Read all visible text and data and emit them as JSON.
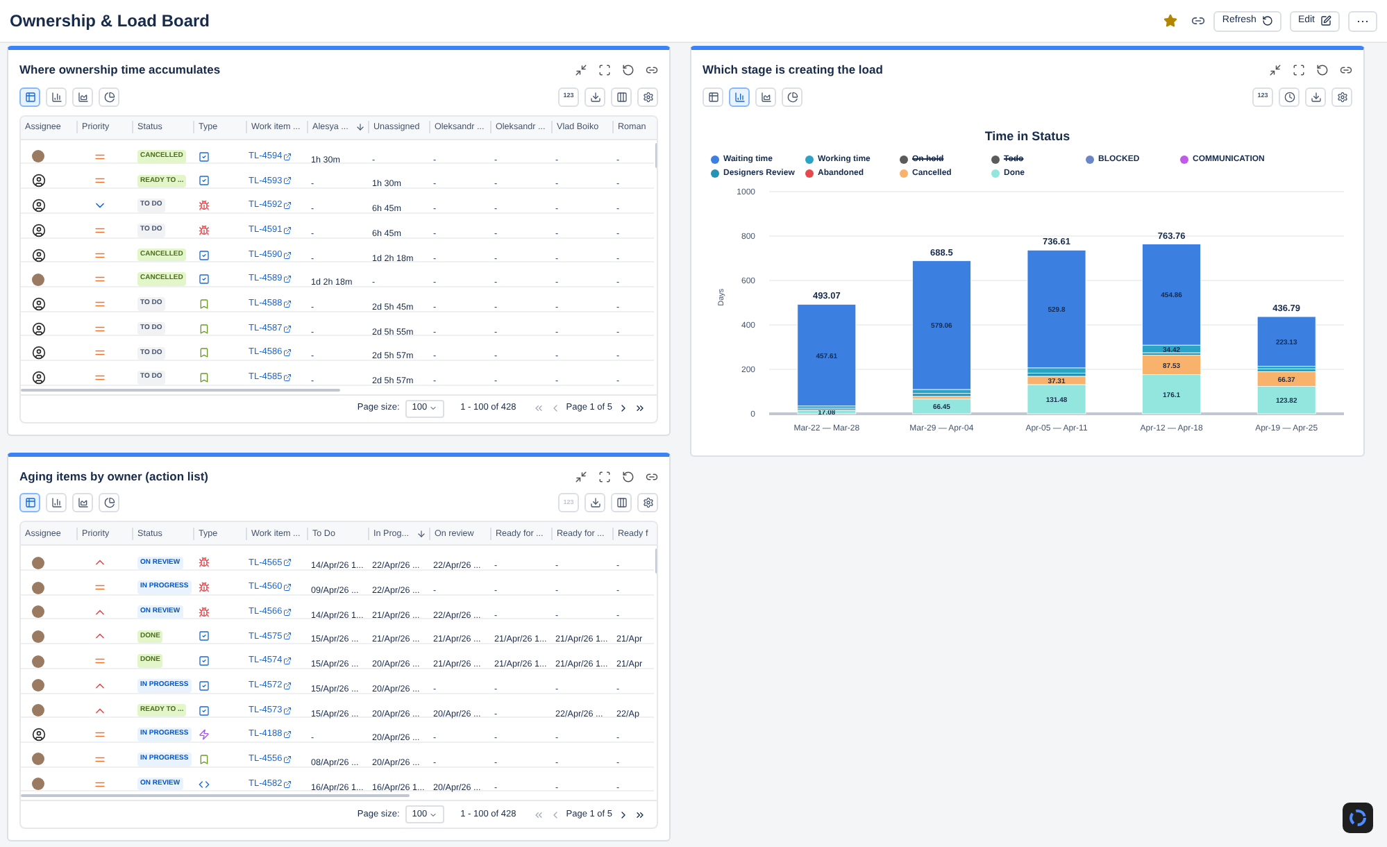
{
  "header": {
    "title": "Ownership & Load Board",
    "favorite": true,
    "refresh_label": "Refresh",
    "edit_label": "Edit",
    "more_label": "⋯"
  },
  "panels": [
    {
      "kind": "table",
      "title": "Where ownership time accumulates",
      "views": [
        {
          "kind": "table",
          "selected": true
        },
        {
          "kind": "bar",
          "selected": false
        },
        {
          "kind": "area",
          "selected": false
        },
        {
          "kind": "pie",
          "selected": false
        }
      ],
      "tools": [
        {
          "kind": "digits",
          "label": "123",
          "disabled": false
        },
        {
          "kind": "download",
          "disabled": false
        },
        {
          "kind": "columns",
          "disabled": false
        },
        {
          "kind": "settings",
          "disabled": false
        }
      ],
      "table": {
        "columns": [
          {
            "label": "Assignee",
            "sorted": false
          },
          {
            "label": "Priority",
            "sorted": false
          },
          {
            "label": "Status",
            "sorted": false
          },
          {
            "label": "Type",
            "sorted": false
          },
          {
            "label": "Work item ...",
            "sorted": false
          },
          {
            "label": "Alesya ...",
            "sorted": true
          },
          {
            "label": "Unassigned",
            "sorted": false
          },
          {
            "label": "Oleksandr ...",
            "sorted": false
          },
          {
            "label": "Oleksandr ...",
            "sorted": false
          },
          {
            "label": "Vlad Boiko",
            "sorted": false
          },
          {
            "label": "Roman",
            "sorted": false
          }
        ],
        "rows": [
          {
            "cells": [
              {
                "kind": "photo"
              },
              {
                "kind": "medium"
              },
              {
                "kind": "positive",
                "text": "CANCELLED"
              },
              {
                "kind": "task"
              },
              {
                "kind": "link",
                "text": "TL-4594"
              },
              {
                "kind": "text",
                "text": "1h 30m"
              },
              {
                "kind": "text",
                "text": "-"
              },
              {
                "kind": "text",
                "text": "-"
              },
              {
                "kind": "text",
                "text": "-"
              },
              {
                "kind": "text",
                "text": "-"
              },
              {
                "kind": "text",
                "text": "-"
              }
            ]
          },
          {
            "cells": [
              {
                "kind": "person"
              },
              {
                "kind": "medium"
              },
              {
                "kind": "positive",
                "text": "READY TO ..."
              },
              {
                "kind": "task"
              },
              {
                "kind": "link",
                "text": "TL-4593"
              },
              {
                "kind": "text",
                "text": "-"
              },
              {
                "kind": "text",
                "text": "1h 30m"
              },
              {
                "kind": "text",
                "text": "-"
              },
              {
                "kind": "text",
                "text": "-"
              },
              {
                "kind": "text",
                "text": "-"
              },
              {
                "kind": "text",
                "text": "-"
              }
            ]
          },
          {
            "cells": [
              {
                "kind": "person"
              },
              {
                "kind": "low"
              },
              {
                "kind": "neutral",
                "text": "TO DO"
              },
              {
                "kind": "bug"
              },
              {
                "kind": "link",
                "text": "TL-4592"
              },
              {
                "kind": "text",
                "text": "-"
              },
              {
                "kind": "text",
                "text": "6h 45m"
              },
              {
                "kind": "text",
                "text": "-"
              },
              {
                "kind": "text",
                "text": "-"
              },
              {
                "kind": "text",
                "text": "-"
              },
              {
                "kind": "text",
                "text": "-"
              }
            ]
          },
          {
            "cells": [
              {
                "kind": "person"
              },
              {
                "kind": "medium"
              },
              {
                "kind": "neutral",
                "text": "TO DO"
              },
              {
                "kind": "bug"
              },
              {
                "kind": "link",
                "text": "TL-4591"
              },
              {
                "kind": "text",
                "text": "-"
              },
              {
                "kind": "text",
                "text": "6h 45m"
              },
              {
                "kind": "text",
                "text": "-"
              },
              {
                "kind": "text",
                "text": "-"
              },
              {
                "kind": "text",
                "text": "-"
              },
              {
                "kind": "text",
                "text": "-"
              }
            ]
          },
          {
            "cells": [
              {
                "kind": "person"
              },
              {
                "kind": "medium"
              },
              {
                "kind": "positive",
                "text": "CANCELLED"
              },
              {
                "kind": "task"
              },
              {
                "kind": "link",
                "text": "TL-4590"
              },
              {
                "kind": "text",
                "text": "-"
              },
              {
                "kind": "text",
                "text": "1d 2h 18m"
              },
              {
                "kind": "text",
                "text": "-"
              },
              {
                "kind": "text",
                "text": "-"
              },
              {
                "kind": "text",
                "text": "-"
              },
              {
                "kind": "text",
                "text": "-"
              }
            ]
          },
          {
            "cells": [
              {
                "kind": "photo"
              },
              {
                "kind": "medium"
              },
              {
                "kind": "positive",
                "text": "CANCELLED"
              },
              {
                "kind": "task"
              },
              {
                "kind": "link",
                "text": "TL-4589"
              },
              {
                "kind": "text",
                "text": "1d 2h 18m"
              },
              {
                "kind": "text",
                "text": "-"
              },
              {
                "kind": "text",
                "text": "-"
              },
              {
                "kind": "text",
                "text": "-"
              },
              {
                "kind": "text",
                "text": "-"
              },
              {
                "kind": "text",
                "text": "-"
              }
            ]
          },
          {
            "cells": [
              {
                "kind": "person"
              },
              {
                "kind": "medium"
              },
              {
                "kind": "neutral",
                "text": "TO DO"
              },
              {
                "kind": "story"
              },
              {
                "kind": "link",
                "text": "TL-4588"
              },
              {
                "kind": "text",
                "text": "-"
              },
              {
                "kind": "text",
                "text": "2d 5h 45m"
              },
              {
                "kind": "text",
                "text": "-"
              },
              {
                "kind": "text",
                "text": "-"
              },
              {
                "kind": "text",
                "text": "-"
              },
              {
                "kind": "text",
                "text": "-"
              }
            ]
          },
          {
            "cells": [
              {
                "kind": "person"
              },
              {
                "kind": "medium"
              },
              {
                "kind": "neutral",
                "text": "TO DO"
              },
              {
                "kind": "story"
              },
              {
                "kind": "link",
                "text": "TL-4587"
              },
              {
                "kind": "text",
                "text": "-"
              },
              {
                "kind": "text",
                "text": "2d 5h 55m"
              },
              {
                "kind": "text",
                "text": "-"
              },
              {
                "kind": "text",
                "text": "-"
              },
              {
                "kind": "text",
                "text": "-"
              },
              {
                "kind": "text",
                "text": "-"
              }
            ]
          },
          {
            "cells": [
              {
                "kind": "person"
              },
              {
                "kind": "medium"
              },
              {
                "kind": "neutral",
                "text": "TO DO"
              },
              {
                "kind": "story"
              },
              {
                "kind": "link",
                "text": "TL-4586"
              },
              {
                "kind": "text",
                "text": "-"
              },
              {
                "kind": "text",
                "text": "2d 5h 57m"
              },
              {
                "kind": "text",
                "text": "-"
              },
              {
                "kind": "text",
                "text": "-"
              },
              {
                "kind": "text",
                "text": "-"
              },
              {
                "kind": "text",
                "text": "-"
              }
            ]
          },
          {
            "cells": [
              {
                "kind": "person"
              },
              {
                "kind": "medium"
              },
              {
                "kind": "neutral",
                "text": "TO DO"
              },
              {
                "kind": "story"
              },
              {
                "kind": "link",
                "text": "TL-4585"
              },
              {
                "kind": "text",
                "text": "-"
              },
              {
                "kind": "text",
                "text": "2d 5h 57m"
              },
              {
                "kind": "text",
                "text": "-"
              },
              {
                "kind": "text",
                "text": "-"
              },
              {
                "kind": "text",
                "text": "-"
              },
              {
                "kind": "text",
                "text": "-"
              }
            ]
          }
        ]
      },
      "pagination": {
        "size_label": "Page size:",
        "size": "100",
        "range": "1 - 100 of 428",
        "page": "Page 1 of 5"
      }
    },
    {
      "kind": "chart",
      "title": "Which stage is creating the load",
      "views": [
        {
          "kind": "table",
          "selected": false
        },
        {
          "kind": "bar",
          "selected": true
        },
        {
          "kind": "area",
          "selected": false
        },
        {
          "kind": "pie",
          "selected": false
        }
      ],
      "tools": [
        {
          "kind": "digits",
          "label": "123",
          "disabled": false
        },
        {
          "kind": "history",
          "disabled": false
        },
        {
          "kind": "download",
          "disabled": false
        },
        {
          "kind": "settings",
          "disabled": false
        }
      ],
      "legend_states": [
        {
          "struck": false
        },
        {
          "struck": false
        },
        {
          "struck": false
        },
        {
          "struck": false
        },
        {
          "struck": false
        },
        {
          "struck": false
        },
        {
          "struck": true
        },
        {
          "struck": true
        },
        {
          "struck": false
        },
        {
          "struck": false
        }
      ],
      "chart_data": {
        "type": "bar",
        "title": "Time in Status",
        "ylabel": "Days",
        "stacked": true,
        "grid": true,
        "legend": true,
        "ylim": [
          0,
          1000
        ],
        "yticks": [
          0,
          200,
          400,
          600,
          800,
          1000
        ],
        "categories": [
          "Mar-22 — Mar-28",
          "Mar-29 — Apr-04",
          "Apr-05 — Apr-11",
          "Apr-12 — Apr-18",
          "Apr-19 — Apr-25"
        ],
        "series": [
          {
            "name": "Done",
            "color": "#93e6dd",
            "values": [
              17.08,
              66.45,
              131.48,
              176.1,
              123.82
            ],
            "value_labels": [
              "17.08",
              "66.45",
              "131.48",
              "176.1",
              "123.82"
            ]
          },
          {
            "name": "Cancelled",
            "color": "#f9b26b",
            "values": [
              null,
              12,
              37.31,
              87.53,
              66.37
            ],
            "value_labels": [
              null,
              null,
              "37.31",
              "87.53",
              "66.37"
            ]
          },
          {
            "name": "Abandoned",
            "color": "#e5484d",
            "values": [
              null,
              null,
              null,
              null,
              null
            ]
          },
          {
            "name": "Designers Review",
            "color": "#2693b5",
            "values": [
              8,
              13,
              14,
              11,
              12
            ],
            "value_labels": [
              null,
              null,
              null,
              null,
              null
            ]
          },
          {
            "name": "Working time",
            "color": "#2aa3c6",
            "values": [
              10,
              18,
              24,
              34.42,
              12
            ],
            "value_labels": [
              null,
              null,
              null,
              "34.42",
              null
            ]
          },
          {
            "name": "Waiting time",
            "color": "#3b7fe0",
            "values": [
              457.61,
              579.06,
              529.8,
              454.86,
              223.13
            ],
            "value_labels": [
              "457.61",
              "579.06",
              "529.8",
              "454.86",
              "223.13"
            ]
          },
          {
            "name": "On hold",
            "color": "#5b5b5b",
            "values": [
              null,
              null,
              null,
              null,
              null
            ]
          },
          {
            "name": "Todo",
            "color": "#5b5b5b",
            "values": [
              null,
              null,
              null,
              null,
              null
            ]
          },
          {
            "name": "BLOCKED",
            "color": "#6b86c6",
            "values": [
              null,
              null,
              null,
              null,
              null
            ]
          },
          {
            "name": "COMMUNICATION",
            "color": "#c05ae8",
            "values": [
              null,
              null,
              null,
              null,
              null
            ]
          }
        ],
        "annotations": [
          {
            "x": "Mar-22 — Mar-28",
            "y": 493.07,
            "text": "493.07"
          },
          {
            "x": "Mar-29 — Apr-04",
            "y": 688.5,
            "text": "688.5"
          },
          {
            "x": "Apr-05 — Apr-11",
            "y": 736.61,
            "text": "736.61"
          },
          {
            "x": "Apr-12 — Apr-18",
            "y": 763.76,
            "text": "763.76"
          },
          {
            "x": "Apr-19 — Apr-25",
            "y": 436.79,
            "text": "436.79"
          }
        ]
      }
    },
    {
      "kind": "table",
      "title": "Aging items by owner (action list)",
      "views": [
        {
          "kind": "table",
          "selected": true
        },
        {
          "kind": "bar",
          "selected": false
        },
        {
          "kind": "area",
          "selected": false
        },
        {
          "kind": "pie",
          "selected": false
        }
      ],
      "tools": [
        {
          "kind": "digits",
          "label": "123",
          "disabled": true
        },
        {
          "kind": "download",
          "disabled": false
        },
        {
          "kind": "columns",
          "disabled": false
        },
        {
          "kind": "settings",
          "disabled": false
        }
      ],
      "table": {
        "columns": [
          {
            "label": "Assignee",
            "sorted": false
          },
          {
            "label": "Priority",
            "sorted": false
          },
          {
            "label": "Status",
            "sorted": false
          },
          {
            "label": "Type",
            "sorted": false
          },
          {
            "label": "Work item ...",
            "sorted": false
          },
          {
            "label": "To Do",
            "sorted": false
          },
          {
            "label": "In Prog...",
            "sorted": true
          },
          {
            "label": "On review",
            "sorted": false
          },
          {
            "label": "Ready for ...",
            "sorted": false
          },
          {
            "label": "Ready for ...",
            "sorted": false
          },
          {
            "label": "Ready f",
            "sorted": false
          }
        ],
        "rows": [
          {
            "cells": [
              {
                "kind": "photo"
              },
              {
                "kind": "high"
              },
              {
                "kind": "info",
                "text": "ON REVIEW"
              },
              {
                "kind": "bug"
              },
              {
                "kind": "link",
                "text": "TL-4565"
              },
              {
                "kind": "text",
                "text": "14/Apr/26 1..."
              },
              {
                "kind": "text",
                "text": "22/Apr/26 ..."
              },
              {
                "kind": "text",
                "text": "22/Apr/26 ..."
              },
              {
                "kind": "text",
                "text": "-"
              },
              {
                "kind": "text",
                "text": "-"
              },
              {
                "kind": "text",
                "text": "-"
              }
            ]
          },
          {
            "cells": [
              {
                "kind": "photo"
              },
              {
                "kind": "medium"
              },
              {
                "kind": "info",
                "text": "IN PROGRESS"
              },
              {
                "kind": "bug"
              },
              {
                "kind": "link",
                "text": "TL-4560"
              },
              {
                "kind": "text",
                "text": "09/Apr/26 ..."
              },
              {
                "kind": "text",
                "text": "22/Apr/26 ..."
              },
              {
                "kind": "text",
                "text": "-"
              },
              {
                "kind": "text",
                "text": "-"
              },
              {
                "kind": "text",
                "text": "-"
              },
              {
                "kind": "text",
                "text": "-"
              }
            ]
          },
          {
            "cells": [
              {
                "kind": "photo"
              },
              {
                "kind": "high"
              },
              {
                "kind": "info",
                "text": "ON REVIEW"
              },
              {
                "kind": "bug"
              },
              {
                "kind": "link",
                "text": "TL-4566"
              },
              {
                "kind": "text",
                "text": "14/Apr/26 1..."
              },
              {
                "kind": "text",
                "text": "21/Apr/26 ..."
              },
              {
                "kind": "text",
                "text": "22/Apr/26 ..."
              },
              {
                "kind": "text",
                "text": "-"
              },
              {
                "kind": "text",
                "text": "-"
              },
              {
                "kind": "text",
                "text": "-"
              }
            ]
          },
          {
            "cells": [
              {
                "kind": "photo"
              },
              {
                "kind": "high"
              },
              {
                "kind": "positive",
                "text": "DONE"
              },
              {
                "kind": "task"
              },
              {
                "kind": "link",
                "text": "TL-4575"
              },
              {
                "kind": "text",
                "text": "15/Apr/26 ..."
              },
              {
                "kind": "text",
                "text": "21/Apr/26 ..."
              },
              {
                "kind": "text",
                "text": "21/Apr/26 ..."
              },
              {
                "kind": "text",
                "text": "21/Apr/26 1..."
              },
              {
                "kind": "text",
                "text": "21/Apr/26 1..."
              },
              {
                "kind": "text",
                "text": "21/Apr"
              }
            ]
          },
          {
            "cells": [
              {
                "kind": "photo"
              },
              {
                "kind": "medium"
              },
              {
                "kind": "positive",
                "text": "DONE"
              },
              {
                "kind": "task"
              },
              {
                "kind": "link",
                "text": "TL-4574"
              },
              {
                "kind": "text",
                "text": "15/Apr/26 ..."
              },
              {
                "kind": "text",
                "text": "20/Apr/26 ..."
              },
              {
                "kind": "text",
                "text": "21/Apr/26 ..."
              },
              {
                "kind": "text",
                "text": "21/Apr/26 1..."
              },
              {
                "kind": "text",
                "text": "21/Apr/26 1..."
              },
              {
                "kind": "text",
                "text": "21/Apr"
              }
            ]
          },
          {
            "cells": [
              {
                "kind": "photo"
              },
              {
                "kind": "high"
              },
              {
                "kind": "info",
                "text": "IN PROGRESS"
              },
              {
                "kind": "task"
              },
              {
                "kind": "link",
                "text": "TL-4572"
              },
              {
                "kind": "text",
                "text": "15/Apr/26 ..."
              },
              {
                "kind": "text",
                "text": "20/Apr/26 ..."
              },
              {
                "kind": "text",
                "text": "-"
              },
              {
                "kind": "text",
                "text": "-"
              },
              {
                "kind": "text",
                "text": "-"
              },
              {
                "kind": "text",
                "text": "-"
              }
            ]
          },
          {
            "cells": [
              {
                "kind": "photo"
              },
              {
                "kind": "high"
              },
              {
                "kind": "positive",
                "text": "READY TO ..."
              },
              {
                "kind": "task"
              },
              {
                "kind": "link",
                "text": "TL-4573"
              },
              {
                "kind": "text",
                "text": "15/Apr/26 ..."
              },
              {
                "kind": "text",
                "text": "20/Apr/26 ..."
              },
              {
                "kind": "text",
                "text": "20/Apr/26 ..."
              },
              {
                "kind": "text",
                "text": "-"
              },
              {
                "kind": "text",
                "text": "22/Apr/26 ..."
              },
              {
                "kind": "text",
                "text": "22/Ap"
              }
            ]
          },
          {
            "cells": [
              {
                "kind": "person"
              },
              {
                "kind": "medium"
              },
              {
                "kind": "info",
                "text": "IN PROGRESS"
              },
              {
                "kind": "epic"
              },
              {
                "kind": "link",
                "text": "TL-4188"
              },
              {
                "kind": "text",
                "text": "-"
              },
              {
                "kind": "text",
                "text": "20/Apr/26 ..."
              },
              {
                "kind": "text",
                "text": "-"
              },
              {
                "kind": "text",
                "text": "-"
              },
              {
                "kind": "text",
                "text": "-"
              },
              {
                "kind": "text",
                "text": "-"
              }
            ]
          },
          {
            "cells": [
              {
                "kind": "photo"
              },
              {
                "kind": "medium"
              },
              {
                "kind": "info",
                "text": "IN PROGRESS"
              },
              {
                "kind": "story"
              },
              {
                "kind": "link",
                "text": "TL-4556"
              },
              {
                "kind": "text",
                "text": "08/Apr/26 ..."
              },
              {
                "kind": "text",
                "text": "20/Apr/26 ..."
              },
              {
                "kind": "text",
                "text": "-"
              },
              {
                "kind": "text",
                "text": "-"
              },
              {
                "kind": "text",
                "text": "-"
              },
              {
                "kind": "text",
                "text": "-"
              }
            ]
          },
          {
            "cells": [
              {
                "kind": "photo"
              },
              {
                "kind": "medium"
              },
              {
                "kind": "info",
                "text": "ON REVIEW"
              },
              {
                "kind": "subtask"
              },
              {
                "kind": "link",
                "text": "TL-4582"
              },
              {
                "kind": "text",
                "text": "16/Apr/26 1..."
              },
              {
                "kind": "text",
                "text": "16/Apr/26 1..."
              },
              {
                "kind": "text",
                "text": "20/Apr/26 ..."
              },
              {
                "kind": "text",
                "text": "-"
              },
              {
                "kind": "text",
                "text": "-"
              },
              {
                "kind": "text",
                "text": "-"
              }
            ]
          }
        ]
      },
      "pagination": {
        "size_label": "Page size:",
        "size": "100",
        "range": "1 - 100 of 428",
        "page": "Page 1 of 5"
      }
    }
  ]
}
